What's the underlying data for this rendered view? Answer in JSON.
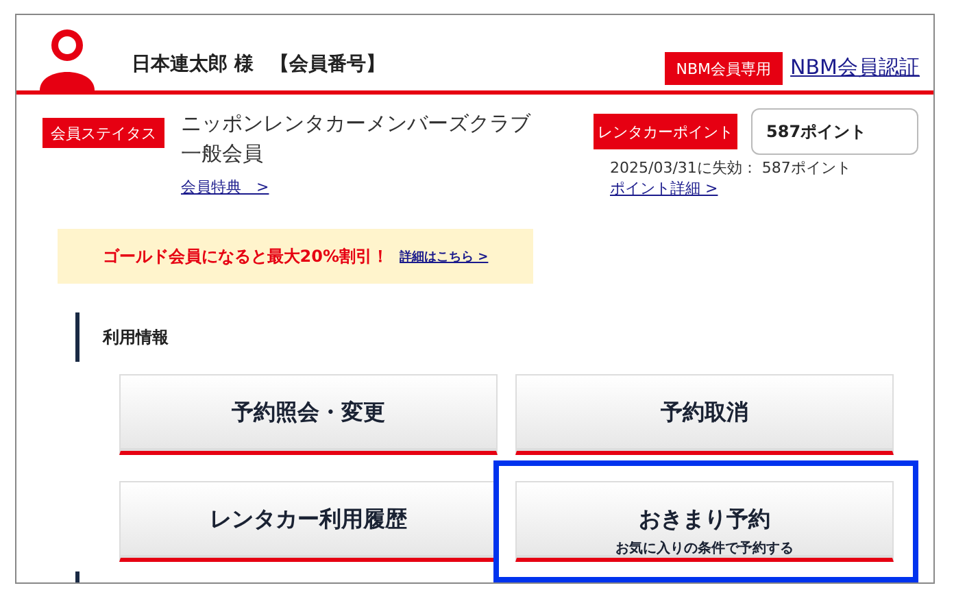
{
  "header": {
    "member_name": "日本連太郎 様",
    "member_number_label": "【会員番号】",
    "badge": "NBM会員専用",
    "auth_link": "NBM会員認証"
  },
  "status": {
    "label": "会員ステイタス",
    "club": "ニッポンレンタカーメンバーズクラブ",
    "rank": "一般会員",
    "benefits_link": "会員特典　>"
  },
  "points": {
    "label": "レンタカーポイント",
    "value": "587ポイント",
    "expiry": "2025/03/31に失効： 587ポイント",
    "detail_link": "ポイント詳細 >"
  },
  "banner": {
    "text": "ゴールド会員になると最大20%割引！",
    "link": "詳細はこちら >"
  },
  "section": {
    "title": "利用情報"
  },
  "buttons": [
    {
      "label": "予約照会・変更",
      "highlighted": false
    },
    {
      "label": "予約取消",
      "highlighted": false
    },
    {
      "label": "レンタカー利用履歴",
      "highlighted": false
    },
    {
      "label": "おきまり予約",
      "sublabel": "お気に入りの条件で予約する",
      "highlighted": true
    }
  ]
}
